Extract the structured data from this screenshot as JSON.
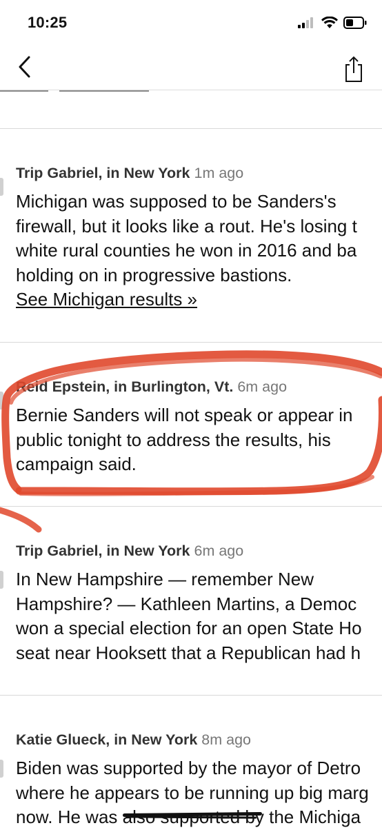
{
  "status_bar": {
    "time": "10:25",
    "signal_icon": "cellular-signal-icon",
    "wifi_icon": "wifi-icon",
    "battery_icon": "battery-icon"
  },
  "nav": {
    "back_icon": "chevron-left-icon",
    "share_icon": "share-icon"
  },
  "posts": [
    {
      "author": "Trip Gabriel, in New York",
      "time": "1m ago",
      "lines": [
        "Michigan was supposed to be Sanders's",
        "firewall, but it looks like a rout. He's losing t",
        "white rural counties he won in 2016 and ba",
        "holding on in progressive bastions."
      ],
      "link": "See Michigan results »"
    },
    {
      "author": "Reid Epstein, in Burlington, Vt.",
      "time": "6m ago",
      "lines": [
        "Bernie Sanders will not speak or appear in",
        "public tonight to address the results, his",
        "campaign said."
      ]
    },
    {
      "author": "Trip Gabriel, in New York",
      "time": "6m ago",
      "lines": [
        "In New Hampshire — remember New",
        "Hampshire? — Kathleen Martins, a Democ",
        "won a special election for an open State Ho",
        "seat near Hooksett that a Republican had h"
      ]
    },
    {
      "author": "Katie Glueck, in New York",
      "time": "8m ago",
      "lines": [
        "Biden was supported by the mayor of Detro",
        "where he appears to be running up big marg",
        "now. He was also supported by the Michiga"
      ]
    }
  ],
  "colors": {
    "annotation": "#e0482c",
    "text": "#121212",
    "meta": "#777777"
  }
}
